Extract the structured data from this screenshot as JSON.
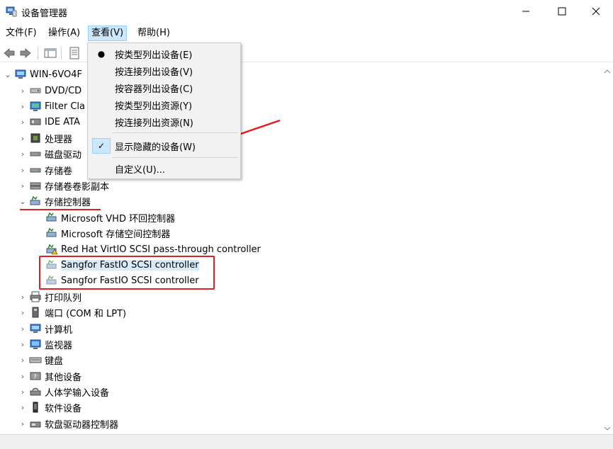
{
  "window": {
    "title": "设备管理器",
    "controls": {
      "minimize": "—",
      "maximize": "☐",
      "close": "✕"
    }
  },
  "menubar": {
    "items": [
      {
        "label": "文件(F)"
      },
      {
        "label": "操作(A)"
      },
      {
        "label": "查看(V)",
        "active": true
      },
      {
        "label": "帮助(H)"
      }
    ]
  },
  "view_menu": {
    "items": [
      {
        "label": "按类型列出设备(E)",
        "mark": "●"
      },
      {
        "label": "按连接列出设备(V)",
        "mark": ""
      },
      {
        "label": "按容器列出设备(C)",
        "mark": ""
      },
      {
        "label": "按类型列出资源(Y)",
        "mark": ""
      },
      {
        "label": "按连接列出资源(N)",
        "mark": ""
      },
      {
        "label": "显示隐藏的设备(W)",
        "mark": "✓"
      },
      {
        "label": "自定义(U)...",
        "mark": ""
      }
    ]
  },
  "tree": {
    "root": "WIN-6VO4F",
    "categories": [
      {
        "label": "DVD/CD",
        "icon": "dvd-icon",
        "expanded": false
      },
      {
        "label": "Filter Cla",
        "icon": "monitor-icon",
        "expanded": false
      },
      {
        "label": "IDE ATA",
        "icon": "ide-icon",
        "expanded": false
      },
      {
        "label": "处理器",
        "icon": "cpu-icon",
        "expanded": false
      },
      {
        "label": "磁盘驱动",
        "icon": "disk-icon",
        "expanded": false
      },
      {
        "label": "存储卷",
        "icon": "disk-icon",
        "expanded": false
      },
      {
        "label": "存储卷卷影副本",
        "icon": "disk-icon",
        "expanded": false
      },
      {
        "label": "存储控制器",
        "icon": "storage-controller-icon",
        "expanded": true
      },
      {
        "label": "Microsoft VHD 环回控制器",
        "icon": "storage-controller-icon",
        "child": true
      },
      {
        "label": "Microsoft 存储空间控制器",
        "icon": "storage-controller-icon",
        "child": true
      },
      {
        "label": "Red Hat VirtIO SCSI pass-through controller",
        "icon": "storage-controller-warning-icon",
        "child": true
      },
      {
        "label": "Sangfor FastIO SCSI controller",
        "icon": "storage-controller-icon",
        "child": true,
        "hidden": true
      },
      {
        "label": "Sangfor FastIO SCSI controller",
        "icon": "storage-controller-icon",
        "child": true,
        "hidden": true
      },
      {
        "label": "打印队列",
        "icon": "printer-icon",
        "expanded": false
      },
      {
        "label": "端口 (COM 和 LPT)",
        "icon": "port-icon",
        "expanded": false
      },
      {
        "label": "计算机",
        "icon": "computer-icon",
        "expanded": false
      },
      {
        "label": "监视器",
        "icon": "monitor-icon",
        "expanded": false
      },
      {
        "label": "键盘",
        "icon": "keyboard-icon",
        "expanded": false
      },
      {
        "label": "其他设备",
        "icon": "unknown-device-icon",
        "expanded": false
      },
      {
        "label": "人体学输入设备",
        "icon": "hid-icon",
        "expanded": false
      },
      {
        "label": "软件设备",
        "icon": "software-device-icon",
        "expanded": false
      },
      {
        "label": "软盘驱动器控制器",
        "icon": "floppy-controller-icon",
        "expanded": false
      }
    ]
  },
  "colors": {
    "annotation": "#e02020",
    "menu_highlight": "#cce8ff",
    "menu_bg": "#f2f2f2"
  }
}
